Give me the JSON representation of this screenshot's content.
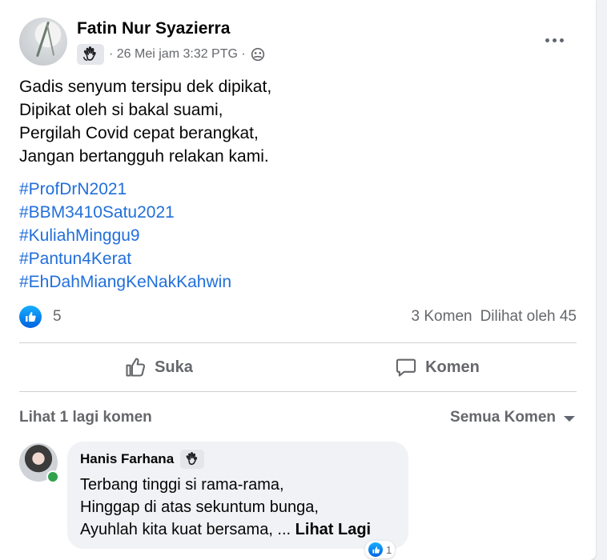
{
  "post": {
    "author": "Fatin Nur Syazierra",
    "meta": "· 26 Mei jam 3:32 PTG ·",
    "body": [
      "Gadis senyum tersipu dek dipikat,",
      "Dipikat oleh si bakal suami,",
      "Pergilah Covid cepat berangkat,",
      "Jangan bertangguh relakan kami."
    ],
    "hashtags": [
      "#ProfDrN2021",
      "#BBM3410Satu2021",
      "#KuliahMinggu9",
      "#Pantun4Kerat",
      "#EhDahMiangKeNakKahwin"
    ],
    "like_count": "5",
    "comments_label": "3 Komen",
    "views_label": "Dilihat oleh 45"
  },
  "actions": {
    "like_label": "Suka",
    "comment_label": "Komen"
  },
  "comments": {
    "more_label": "Lihat 1 lagi komen",
    "sort_label": "Semua Komen",
    "items": [
      {
        "name": "Hanis Farhana",
        "lines": [
          "Terbang tinggi si rama-rama,",
          "Hinggap di atas sekuntum bunga,",
          "Ayuhlah kita kuat bersama, ..."
        ],
        "see_more": "Lihat Lagi",
        "reaction_count": "1"
      }
    ]
  },
  "icons": {
    "wave_badge": "waving-hand-icon",
    "privacy": "friends-globe-icon",
    "more": "more-horizontal-icon",
    "like_reaction": "thumbs-up-icon",
    "like_action": "thumbs-up-outline-icon",
    "comment_action": "speech-bubble-icon",
    "sort": "caret-down-icon"
  },
  "colors": {
    "link": "#216fdb",
    "secondary_text": "#65676b",
    "like_blue": "#0866ff",
    "online": "#31a24c"
  }
}
